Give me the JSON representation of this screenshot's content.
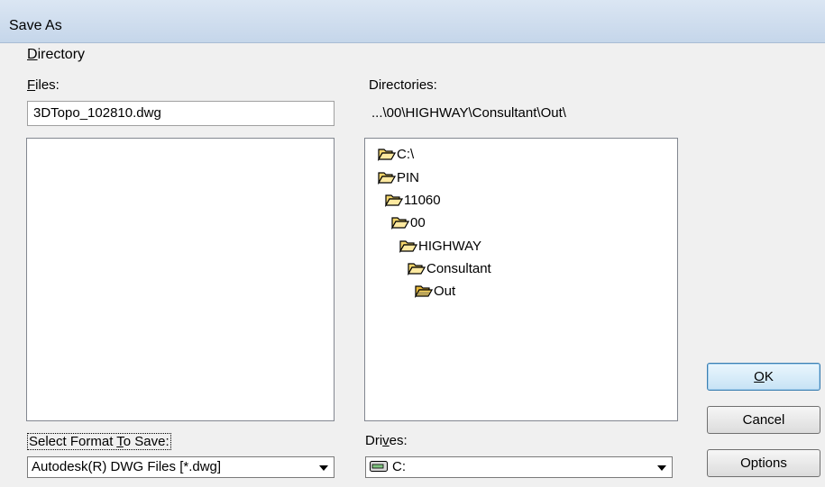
{
  "window": {
    "title": "Save As"
  },
  "menu": {
    "items": [
      {
        "prefix": "",
        "accel": "D",
        "rest": "irectory"
      }
    ]
  },
  "files": {
    "label_accel": "F",
    "label_rest": "iles:",
    "filename_value": "3DTopo_102810.dwg",
    "list_items": []
  },
  "directories": {
    "label": "Directories:",
    "current_path": "...\\00\\HIGHWAY\\Consultant\\Out\\",
    "tree": [
      {
        "label": "C:\\",
        "icon": "open-folder-icon"
      },
      {
        "label": "PIN",
        "icon": "open-folder-icon"
      },
      {
        "label": "11060",
        "icon": "open-folder-icon"
      },
      {
        "label": "00",
        "icon": "open-folder-icon"
      },
      {
        "label": "HIGHWAY",
        "icon": "open-folder-icon"
      },
      {
        "label": "Consultant",
        "icon": "open-folder-icon"
      },
      {
        "label": "Out",
        "icon": "selected-open-folder-icon"
      }
    ]
  },
  "format": {
    "label_a": "Select Format ",
    "label_accel": "T",
    "label_b": "o Save:",
    "selected": "Autodesk(R) DWG Files [*.dwg]"
  },
  "drives": {
    "label_a": "Dri",
    "label_accel": "v",
    "label_b": "es:",
    "selected": "C:",
    "icon": "drive-icon"
  },
  "buttons": {
    "ok_accel": "O",
    "ok_rest": "K",
    "cancel": "Cancel",
    "options": "Options"
  }
}
